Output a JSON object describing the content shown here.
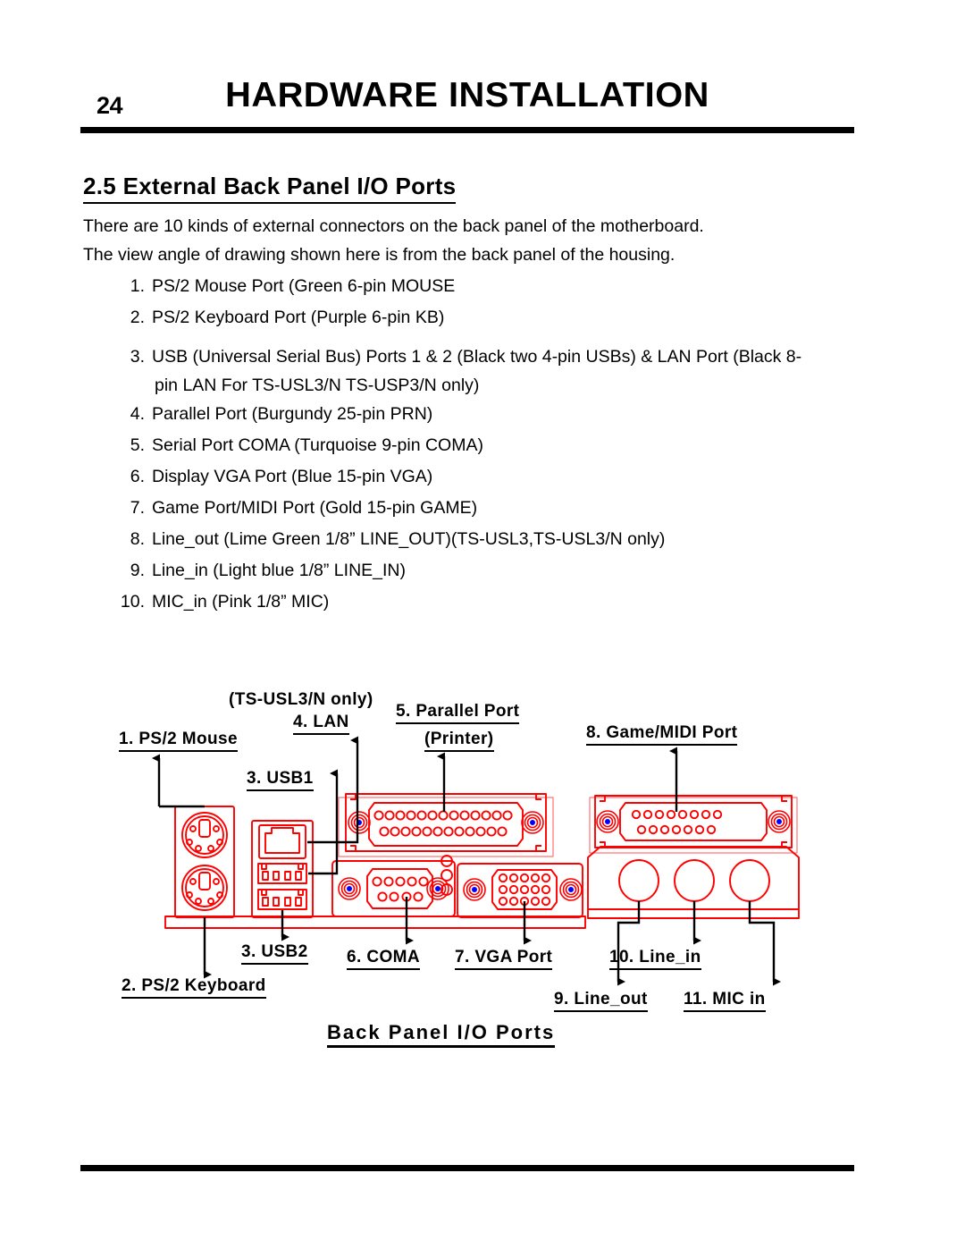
{
  "header": {
    "page_number": "24",
    "chapter_title": "HARDWARE INSTALLATION"
  },
  "section": {
    "heading": "2.5 External Back Panel I/O Ports"
  },
  "intro": {
    "line1": "There are 10 kinds of external connectors on the back panel of the motherboard.",
    "line2": "The view angle of drawing shown here is from the back panel of the housing."
  },
  "port_list": [
    {
      "num": "1.",
      "text": "PS/2 Mouse Port (Green 6-pin MOUSE",
      "cont": ""
    },
    {
      "num": "2.",
      "text": "PS/2 Keyboard Port (Purple 6-pin KB)",
      "cont": ""
    },
    {
      "num": "3.",
      "text": "USB (Universal Serial Bus) Ports 1 & 2 (Black two 4-pin USBs) & LAN Port (Black 8-",
      "cont": "pin LAN For TS-USL3/N TS-USP3/N only)"
    },
    {
      "num": "4.",
      "text": "Parallel Port (Burgundy 25-pin PRN)",
      "cont": ""
    },
    {
      "num": "5.",
      "text": "Serial Port COMA (Turquoise 9-pin COMA)",
      "cont": ""
    },
    {
      "num": "6.",
      "text": "Display VGA Port (Blue 15-pin VGA)",
      "cont": ""
    },
    {
      "num": "7.",
      "text": " Game Port/MIDI Port (Gold 15-pin GAME)",
      "cont": ""
    },
    {
      "num": "8.",
      "text": "Line_out (Lime Green 1/8” LINE_OUT)(TS-USL3,TS-USL3/N only)",
      "cont": ""
    },
    {
      "num": "9.",
      "text": "Line_in (Light blue 1/8” LINE_IN)",
      "cont": ""
    },
    {
      "num": "10.",
      "text": "MIC_in (Pink 1/8” MIC)",
      "cont": ""
    }
  ],
  "figure": {
    "caption": "Back Panel I/O Ports",
    "labels": {
      "ps2_mouse": "1. PS/2 Mouse",
      "usb1": "3. USB1",
      "lan_note": "(TS-USL3/N only)",
      "lan": "4. LAN",
      "parallel_1": "5. Parallel Port",
      "parallel_2": "(Printer)",
      "game_midi": "8. Game/MIDI Port",
      "usb2": "3. USB2",
      "ps2_keyboard": "2. PS/2 Keyboard",
      "coma": "6. COMA",
      "vga": "7. VGA Port",
      "line_in": "10. Line_in",
      "line_out": "9. Line_out",
      "mic_in": "11. MIC in"
    }
  },
  "colors": {
    "drawing_outline": "#FF0000",
    "screw_center": "#0000FF",
    "text": "#000000",
    "background": "#FFFFFF"
  }
}
